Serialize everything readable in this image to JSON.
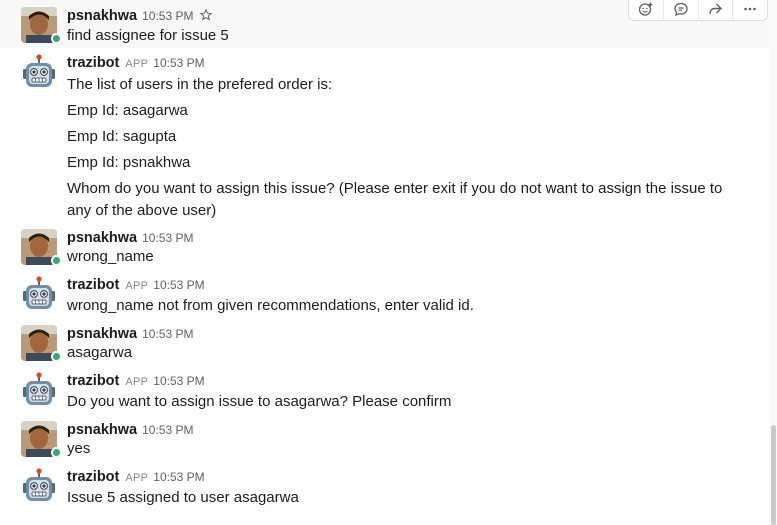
{
  "actions": {
    "add_reaction_icon": "emoji-plus-icon",
    "reply_icon": "speech-bubble-icon",
    "share_icon": "share-arrow-icon",
    "more_icon": "more-horizontal-icon"
  },
  "colors": {
    "presence": "#2bac76",
    "hover_bg": "#f8f8f8",
    "bot_head": "#6e8fa6"
  },
  "messages": [
    {
      "sender": "psnakhwa",
      "time": "10:53 PM",
      "lines": [
        "find assignee for issue 5"
      ]
    },
    {
      "sender": "trazibot",
      "app": "APP",
      "time": "10:53 PM",
      "lines": [
        "The list of users in the prefered order is:",
        "Emp Id: asagarwa",
        "Emp Id: sagupta",
        "Emp Id: psnakhwa",
        "Whom do you want to assign this issue? (Please enter exit if you do not want to assign the issue to",
        "any of the above user)"
      ]
    },
    {
      "sender": "psnakhwa",
      "time": "10:53 PM",
      "lines": [
        "wrong_name"
      ]
    },
    {
      "sender": "trazibot",
      "app": "APP",
      "time": "10:53 PM",
      "lines": [
        "wrong_name not from given recommendations, enter valid id."
      ]
    },
    {
      "sender": "psnakhwa",
      "time": "10:53 PM",
      "lines": [
        "asagarwa"
      ]
    },
    {
      "sender": "trazibot",
      "app": "APP",
      "time": "10:53 PM",
      "lines": [
        "Do you want to assign issue to asagarwa? Please confirm"
      ]
    },
    {
      "sender": "psnakhwa",
      "time": "10:53 PM",
      "lines": [
        "yes"
      ]
    },
    {
      "sender": "trazibot",
      "app": "APP",
      "time": "10:53 PM",
      "lines": [
        "Issue 5 assigned to user asagarwa"
      ]
    }
  ]
}
